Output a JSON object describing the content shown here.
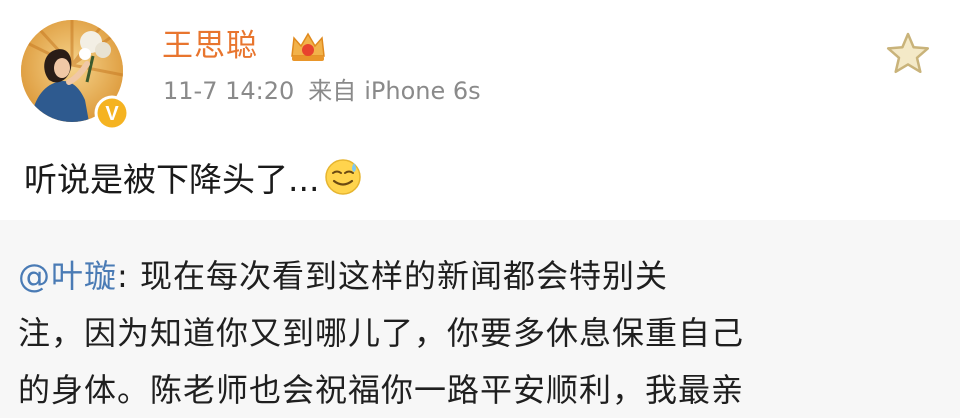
{
  "post": {
    "username": "王思聪",
    "timestamp": "11-7 14:20",
    "source_prefix": "来自",
    "source_device": "iPhone 6s",
    "text": "听说是被下降头了...",
    "icons": {
      "avatar": "user-avatar",
      "verified_badge": "verified-badge-icon",
      "member_crown": "member-crown-icon",
      "favorite": "star-icon",
      "emoji": "sweat-smile-emoji-icon"
    }
  },
  "repost": {
    "mention": "@叶璇",
    "separator": ":",
    "line1_rest": " 现在每次看到这样的新闻都会特别关",
    "line2": "注，因为知道你又到哪儿了，你要多休息保重自己",
    "line3": "的身体。陈老师也会祝福你一路平安顺利，我最亲"
  },
  "colors": {
    "username": "#e8752e",
    "meta": "#8a8a8a",
    "mention": "#4a7bb5",
    "repost_bg": "#f7f7f7",
    "verified_badge": "#f5b321"
  }
}
